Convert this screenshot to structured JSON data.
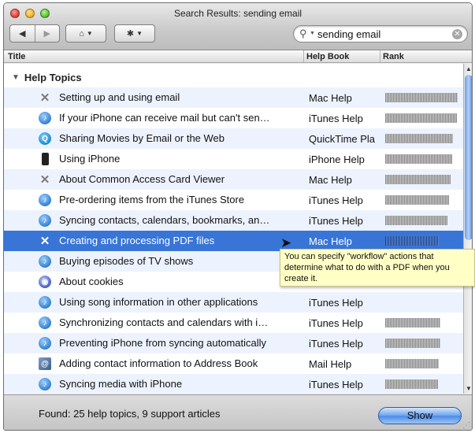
{
  "window": {
    "title": "Search Results: sending email"
  },
  "toolbar": {
    "back_icon": "back-arrow-icon",
    "forward_icon": "forward-arrow-icon",
    "home_icon": "home-icon",
    "action_icon": "gear-icon",
    "search_value": "sending email"
  },
  "columns": {
    "title": "Title",
    "book": "Help Book",
    "rank": "Rank"
  },
  "group": {
    "label": "Help Topics"
  },
  "rows": [
    {
      "title": "Setting up and using email",
      "book": "Mac Help",
      "icon": "mac-help-icon",
      "rank": 0.98
    },
    {
      "title": "If your iPhone can receive mail but can't sen…",
      "book": "iTunes Help",
      "icon": "itunes-icon",
      "rank": 0.97
    },
    {
      "title": "Sharing Movies by Email or the Web",
      "book": "QuickTime Pla",
      "icon": "quicktime-icon",
      "rank": 0.92
    },
    {
      "title": "Using iPhone",
      "book": "iPhone Help",
      "icon": "iphone-icon",
      "rank": 0.9
    },
    {
      "title": "About Common Access Card Viewer",
      "book": "Mac Help",
      "icon": "mac-help-icon",
      "rank": 0.88
    },
    {
      "title": "Pre-ordering items from the iTunes Store",
      "book": "iTunes Help",
      "icon": "itunes-icon",
      "rank": 0.86
    },
    {
      "title": "Syncing contacts, calendars, bookmarks, an…",
      "book": "iTunes Help",
      "icon": "itunes-icon",
      "rank": 0.84
    },
    {
      "title": "Creating and processing PDF files",
      "book": "Mac Help",
      "icon": "mac-help-icon",
      "rank": 0.72,
      "selected": true
    },
    {
      "title": "Buying episodes of TV shows",
      "book": "",
      "icon": "itunes-icon",
      "rank": 0
    },
    {
      "title": "About cookies",
      "book": "",
      "icon": "safari-icon",
      "rank": 0
    },
    {
      "title": "Using song information in other applications",
      "book": "iTunes Help",
      "icon": "itunes-icon",
      "rank": 0
    },
    {
      "title": "Synchronizing contacts and calendars with i…",
      "book": "iTunes Help",
      "icon": "itunes-icon",
      "rank": 0.74
    },
    {
      "title": "Preventing iPhone from syncing automatically",
      "book": "iTunes Help",
      "icon": "itunes-icon",
      "rank": 0.74
    },
    {
      "title": "Adding contact information to Address Book",
      "book": "Mail Help",
      "icon": "address-book-icon",
      "rank": 0.72
    },
    {
      "title": "Syncing media with iPhone",
      "book": "iTunes Help",
      "icon": "itunes-icon",
      "rank": 0.71
    }
  ],
  "tooltip": {
    "text": "You can specify \"workflow\" actions that determine what to do with a PDF when you create it."
  },
  "footer": {
    "found": "Found: 25 help topics, 9 support articles",
    "show_label": "Show"
  }
}
